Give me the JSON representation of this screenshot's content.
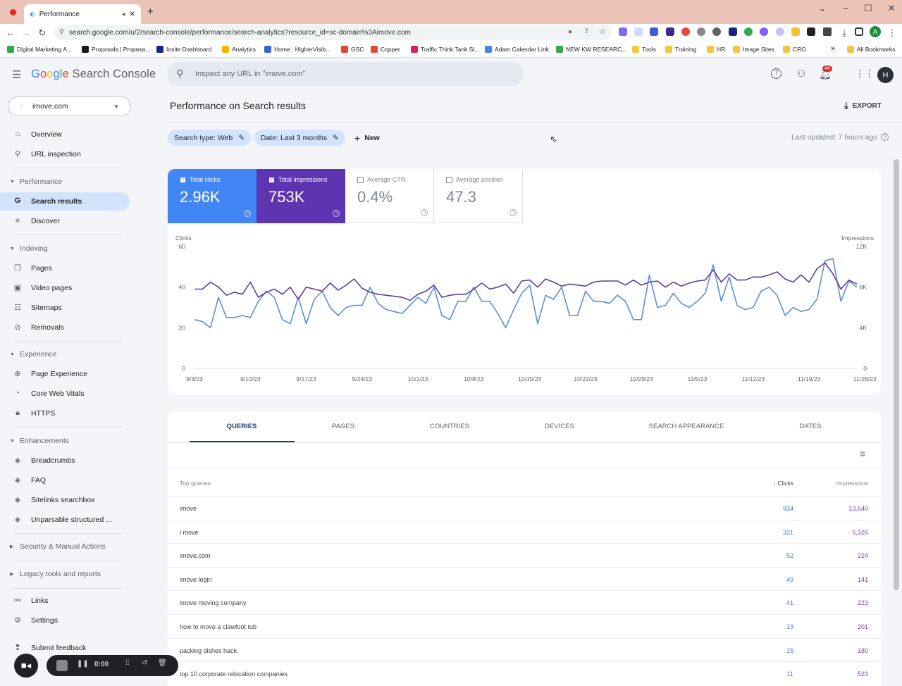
{
  "browser": {
    "tab_title": "Performance",
    "url": "search.google.com/u/2/search-console/performance/search-analytics?resource_id=sc-domain%3Aimove.com",
    "bookmarks": [
      "Digital Marketing A...",
      "Proposals | Proposa...",
      "Insite Dashboard",
      "Analytics",
      "Home : HigherVisib...",
      "GSC",
      "Copper",
      "Traffic Think Tank Sl...",
      "Adam Calendar Link",
      "NEW KW RESEARC...",
      "Tools",
      "Training",
      "HR",
      "Image Sites",
      "CRO"
    ],
    "all_bookmarks": "All Bookmarks",
    "profile_initial": "A"
  },
  "header": {
    "logo_google": "Google",
    "logo_product": "Search Console",
    "search_placeholder": "Inspect any URL in \"imove.com\"",
    "notification_count": "44",
    "user_initial": "H"
  },
  "sidebar": {
    "property": "imove.com",
    "overview": "Overview",
    "url_inspection": "URL inspection",
    "performance": "Performance",
    "search_results": "Search results",
    "discover": "Discover",
    "indexing": "Indexing",
    "pages": "Pages",
    "video_pages": "Video pages",
    "sitemaps": "Sitemaps",
    "removals": "Removals",
    "experience": "Experience",
    "page_experience": "Page Experience",
    "core_web_vitals": "Core Web Vitals",
    "https": "HTTPS",
    "enhancements": "Enhancements",
    "breadcrumbs": "Breadcrumbs",
    "faq": "FAQ",
    "sitelinks": "Sitelinks searchbox",
    "unparsable": "Unparsable structured ...",
    "security": "Security & Manual Actions",
    "legacy": "Legacy tools and reports",
    "links": "Links",
    "settings": "Settings",
    "submit_feedback": "Submit feedback"
  },
  "main": {
    "title": "Performance on Search results",
    "export": "EXPORT",
    "filter_search_type": "Search type: Web",
    "filter_date": "Date: Last 3 months",
    "new": "New",
    "last_updated": "Last updated: 7 hours ago"
  },
  "metrics": {
    "clicks_label": "Total clicks",
    "clicks_value": "2.96K",
    "impressions_label": "Total impressions",
    "impressions_value": "753K",
    "ctr_label": "Average CTR",
    "ctr_value": "0.4%",
    "position_label": "Average position",
    "position_value": "47.3"
  },
  "colors": {
    "clicks": "#4285f4",
    "impressions": "#5e35b1",
    "clicks_line": "#5b8fdc",
    "impressions_line": "#5b3fa0"
  },
  "chart_data": {
    "type": "line",
    "left_axis_label": "Clicks",
    "right_axis_label": "Impressions",
    "y_left_ticks": [
      "60",
      "40",
      "20",
      "0"
    ],
    "y_right_ticks": [
      "12K",
      "8K",
      "4K",
      "0"
    ],
    "ylim_left": [
      0,
      60
    ],
    "ylim_right": [
      0,
      12000
    ],
    "x_tick_labels": [
      "9/3/23",
      "9/10/23",
      "9/17/23",
      "9/24/23",
      "10/1/23",
      "10/8/23",
      "10/15/23",
      "10/22/23",
      "10/29/23",
      "11/5/23",
      "11/12/23",
      "11/19/23",
      "11/26/23"
    ],
    "series": [
      {
        "name": "Clicks",
        "axis": "left",
        "values": [
          24,
          23,
          20,
          35,
          25,
          25,
          26,
          25,
          33,
          38,
          35,
          24,
          22,
          35,
          22,
          34,
          38,
          30,
          26,
          30,
          31,
          31,
          40,
          32,
          29,
          28,
          27,
          31,
          35,
          32,
          40,
          26,
          24,
          33,
          33,
          40,
          33,
          33,
          27,
          20,
          29,
          37,
          41,
          22,
          36,
          34,
          40,
          26,
          26,
          38,
          33,
          33,
          32,
          36,
          33,
          24,
          24,
          46,
          30,
          31,
          37,
          32,
          30,
          33,
          37,
          51,
          33,
          45,
          31,
          29,
          30,
          38,
          40,
          36,
          26,
          30,
          28,
          29,
          34,
          53,
          54,
          33,
          43,
          40
        ]
      },
      {
        "name": "Impressions",
        "axis": "right",
        "values": [
          7800,
          7800,
          8500,
          8000,
          7200,
          7500,
          7300,
          8500,
          7000,
          7500,
          7800,
          7300,
          8000,
          6800,
          8000,
          7800,
          7600,
          8400,
          7700,
          8200,
          8800,
          7900,
          7500,
          7300,
          7200,
          7100,
          7000,
          6700,
          7300,
          7600,
          8200,
          7000,
          7200,
          7300,
          7300,
          7800,
          8400,
          7800,
          8000,
          8300,
          7400,
          8600,
          8700,
          8000,
          8800,
          8500,
          8100,
          8300,
          8200,
          8100,
          8500,
          8600,
          8600,
          8600,
          8200,
          8700,
          8200,
          8500,
          8600,
          8000,
          8500,
          8100,
          8400,
          8600,
          8700,
          9700,
          8500,
          9300,
          8700,
          8700,
          9000,
          9000,
          9200,
          9500,
          8800,
          8500,
          9200,
          8500,
          9800,
          10400,
          9300,
          7800,
          8700,
          8300
        ]
      }
    ]
  },
  "table": {
    "tabs": [
      "QUERIES",
      "PAGES",
      "COUNTRIES",
      "DEVICES",
      "SEARCH APPEARANCE",
      "DATES"
    ],
    "col_query": "Top queries",
    "col_clicks": "Clicks",
    "col_impressions": "Impressions",
    "rows": [
      {
        "query": "imove",
        "clicks": "934",
        "impressions": "13,640"
      },
      {
        "query": "i move",
        "clicks": "321",
        "impressions": "6,326"
      },
      {
        "query": "imove.com",
        "clicks": "52",
        "impressions": "224"
      },
      {
        "query": "imove login",
        "clicks": "49",
        "impressions": "141"
      },
      {
        "query": "imove moving company",
        "clicks": "41",
        "impressions": "223"
      },
      {
        "query": "how to move a clawfoot tub",
        "clicks": "19",
        "impressions": "201"
      },
      {
        "query": "packing dishes hack",
        "clicks": "15",
        "impressions": "180"
      },
      {
        "query": "top 10 corporate relocation companies",
        "clicks": "11",
        "impressions": "523"
      }
    ]
  },
  "recorder": {
    "time": "0:00"
  }
}
